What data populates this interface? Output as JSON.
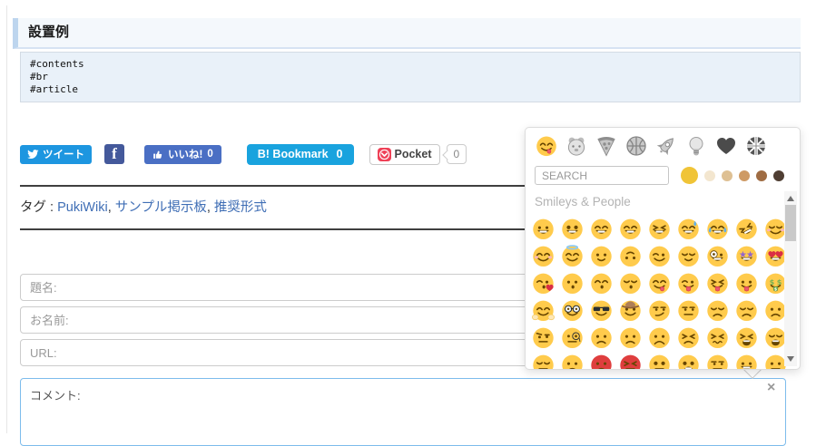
{
  "header": {
    "title": "設置例"
  },
  "code_block": {
    "lines": [
      "#contents",
      "#br",
      "#article"
    ]
  },
  "share": {
    "tweet_label": "ツイート",
    "facebook_label": "f",
    "like_label": "いいね!",
    "like_count": "0",
    "hatena_label": "B! Bookmark",
    "hatena_count": "0",
    "pocket_label": "Pocket",
    "pocket_count": "0"
  },
  "tags": {
    "label": "タグ :",
    "items": [
      "PukiWiki",
      "サンプル掲示板",
      "推奨形式"
    ]
  },
  "form": {
    "title_placeholder": "題名:",
    "name_placeholder": "お名前:",
    "url_placeholder": "URL:",
    "comment_placeholder": "コメント:",
    "close_label": "×"
  },
  "picker": {
    "search_placeholder": "SEARCH",
    "section_title": "Smileys & People",
    "active_category_index": 0,
    "categories": [
      "Smileys & People",
      "Animals & Nature",
      "Food & Drink",
      "Activity",
      "Travel & Places",
      "Objects",
      "Symbols",
      "Flags"
    ],
    "skin_tones": [
      "#F0C437",
      "#F3E6CF",
      "#DEC093",
      "#CE9A64",
      "#9F6C43",
      "#4F3E33"
    ],
    "emoji_rows": [
      [
        {
          "c": "😀",
          "e": "dot",
          "m": "grin"
        },
        {
          "c": "😃",
          "e": "round",
          "m": "grin"
        },
        {
          "c": "😄",
          "e": "happy",
          "m": "grin"
        },
        {
          "c": "😁",
          "e": "happy",
          "m": "grin"
        },
        {
          "c": "😆",
          "e": "squint",
          "m": "grin"
        },
        {
          "c": "😅",
          "e": "happy",
          "m": "grin",
          "x": [
            "sweat"
          ]
        },
        {
          "c": "😂",
          "e": "happy",
          "m": "grin",
          "x": [
            "tears"
          ]
        },
        {
          "c": "🤣",
          "e": "squint",
          "m": "grin",
          "x": [
            "rot"
          ]
        },
        {
          "c": "☺️",
          "e": "closed",
          "m": "smile",
          "x": [
            "blush"
          ]
        }
      ],
      [
        {
          "c": "😊",
          "e": "happy",
          "m": "smile",
          "x": [
            "blush"
          ]
        },
        {
          "c": "😇",
          "e": "happy",
          "m": "smile",
          "x": [
            "halo"
          ]
        },
        {
          "c": "🙂",
          "e": "dot",
          "m": "soft"
        },
        {
          "c": "🙃",
          "e": "dot",
          "m": "soft",
          "x": [
            "flip"
          ]
        },
        {
          "c": "😉",
          "e": "wink",
          "m": "smile"
        },
        {
          "c": "😌",
          "e": "closed",
          "m": "soft"
        },
        {
          "c": "🤪",
          "e": "big",
          "m": "grin"
        },
        {
          "c": "🤩",
          "e": "stars",
          "m": "grin"
        },
        {
          "c": "😍",
          "e": "hearts",
          "m": "grin"
        }
      ],
      [
        {
          "c": "😘",
          "e": "wink",
          "m": "kiss",
          "x": [
            "heartside"
          ]
        },
        {
          "c": "😗",
          "e": "dot",
          "m": "kiss"
        },
        {
          "c": "😙",
          "e": "happy",
          "m": "kiss"
        },
        {
          "c": "😚",
          "e": "closed",
          "m": "kiss"
        },
        {
          "c": "😋",
          "e": "happy",
          "m": "lick"
        },
        {
          "c": "😜",
          "e": "wink",
          "m": "stick"
        },
        {
          "c": "😝",
          "e": "squint",
          "m": "stick"
        },
        {
          "c": "😛",
          "e": "dot",
          "m": "stick"
        },
        {
          "c": "🤑",
          "e": "dollar",
          "m": "stickgreen"
        }
      ],
      [
        {
          "c": "🤗",
          "e": "happy",
          "m": "smile",
          "x": [
            "hands"
          ]
        },
        {
          "c": "🤓",
          "e": "nerd",
          "m": "smile"
        },
        {
          "c": "😎",
          "e": "shades",
          "m": "smile"
        },
        {
          "c": "🤠",
          "e": "dot",
          "m": "smile",
          "x": [
            "hat"
          ]
        },
        {
          "c": "😏",
          "e": "lid",
          "m": "smirk"
        },
        {
          "c": "😒",
          "e": "lid",
          "m": "flat"
        },
        {
          "c": "😞",
          "e": "closed",
          "m": "frown"
        },
        {
          "c": "😔",
          "e": "closed",
          "m": "frown"
        },
        {
          "c": "😟",
          "e": "dot",
          "m": "frown"
        }
      ],
      [
        {
          "c": "🤨",
          "e": "brow",
          "m": "flat"
        },
        {
          "c": "🧐",
          "e": "monocle",
          "m": "flat"
        },
        {
          "c": "😕",
          "e": "dot",
          "m": "frown"
        },
        {
          "c": "🙁",
          "e": "dot",
          "m": "frown"
        },
        {
          "c": "☹️",
          "e": "dot",
          "m": "bigfrown"
        },
        {
          "c": "😣",
          "e": "squint",
          "m": "frown"
        },
        {
          "c": "😖",
          "e": "squint",
          "m": "squiggle"
        },
        {
          "c": "😫",
          "e": "squint",
          "m": "openfrown"
        },
        {
          "c": "😩",
          "e": "closed",
          "m": "openfrown"
        }
      ],
      [
        {
          "c": "😤",
          "e": "closed",
          "m": "flat"
        },
        {
          "c": "😠",
          "e": "dot",
          "m": "frown"
        },
        {
          "c": "😡",
          "e": "dot",
          "m": "frown",
          "t": "r"
        },
        {
          "c": "🤬",
          "e": "squint",
          "m": "flat",
          "t": "r"
        },
        {
          "c": "😳",
          "e": "round",
          "m": "flat"
        },
        {
          "c": "😱",
          "e": "round",
          "m": "openfrown"
        },
        {
          "c": "🙄",
          "e": "lid",
          "m": "flat"
        },
        {
          "c": "😬",
          "e": "dot",
          "m": "grin"
        },
        {
          "c": "🤔",
          "e": "dot",
          "m": "flat"
        }
      ]
    ]
  }
}
